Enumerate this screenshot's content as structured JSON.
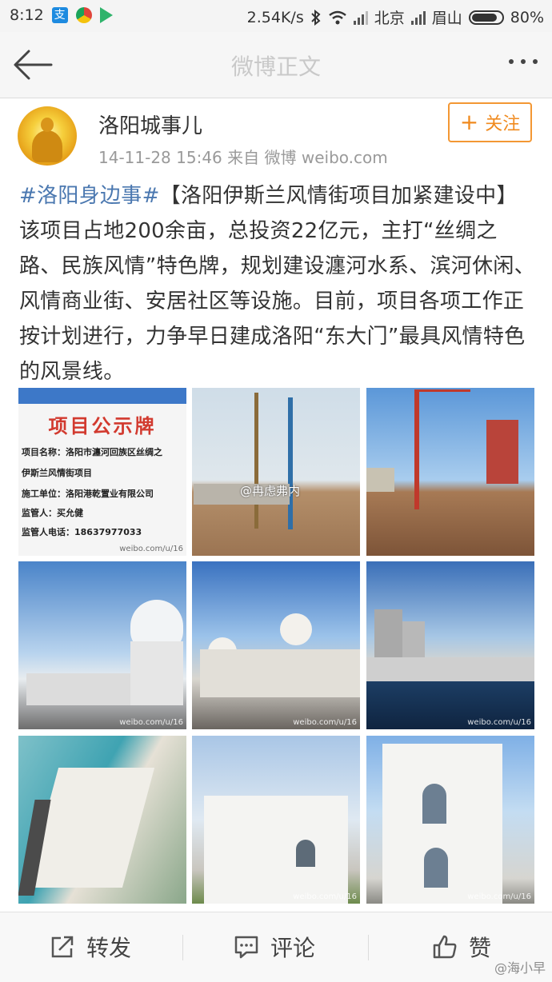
{
  "status_bar": {
    "time": "8:12",
    "speed": "2.54K/s",
    "carrier1": "北京",
    "carrier2": "眉山",
    "battery": "80%"
  },
  "nav": {
    "title": "微博正文"
  },
  "post": {
    "username": "洛阳城事儿",
    "meta": "14-11-28 15:46   来自 微博 weibo.com",
    "follow_label": "关注",
    "hashtag": "#洛阳身边事#",
    "body": "【洛阳伊斯兰风情街项目加紧建设中】该项目占地200余亩，总投资22亿元，主打“丝绸之路、民族风情”特色牌，规划建设瀍河水系、滨河休闲、风情商业街、安居社区等设施。目前，项目各项工作正按计划进行，力争早日建成洛阳“东大门”最具风情特色的风景线。"
  },
  "images": {
    "sign_title": "项目公示牌",
    "sign_line1": "项目名称：洛阳市瀍河回族区丝绸之",
    "sign_line2": "伊斯兰风情街项目",
    "sign_line3": "施工单位：洛阳港乾置业有限公司",
    "sign_line4": "监管人：买允健",
    "sign_line5": "监管人电话：18637977033",
    "watermark_site": "weibo.com/u/16",
    "overlay_tag": "@冉虑弗内"
  },
  "actions": {
    "repost": "转发",
    "comment": "评论",
    "like": "赞"
  },
  "bottom_watermark": "@海小早"
}
